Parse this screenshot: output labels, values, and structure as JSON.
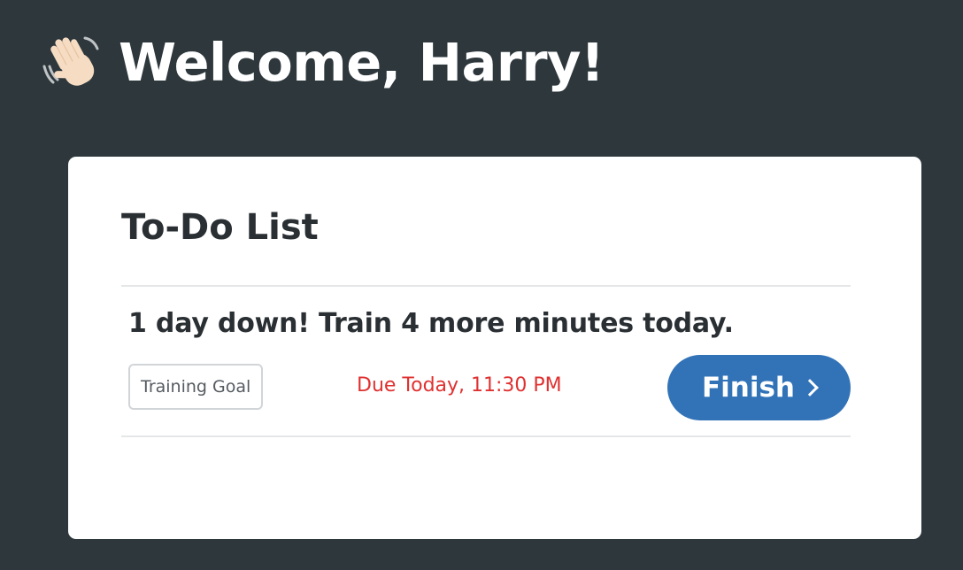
{
  "header": {
    "icon": "waving-hand-icon",
    "title": "Welcome, Harry!"
  },
  "todo": {
    "title": "To-Do List",
    "items": [
      {
        "task": "1 day down! Train 4 more minutes today.",
        "tag": "Training Goal",
        "due": "Due Today, 11:30 PM",
        "action_label": "Finish"
      }
    ]
  },
  "colors": {
    "background": "#2d373c",
    "card": "#ffffff",
    "due_text": "#e03131",
    "button": "#3273b8"
  }
}
